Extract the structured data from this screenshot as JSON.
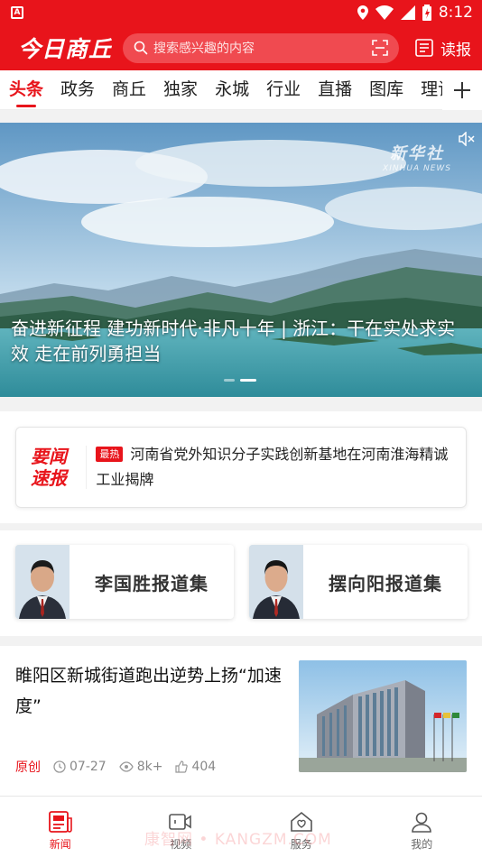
{
  "status_bar": {
    "app_icon_letter": "A",
    "time": "8:12"
  },
  "header": {
    "logo_text": "今日商丘",
    "search_placeholder": "搜索感兴趣的内容",
    "reader_label": "读报"
  },
  "tabs": {
    "items": [
      "头条",
      "政务",
      "商丘",
      "独家",
      "永城",
      "行业",
      "直播",
      "图库",
      "理论"
    ],
    "active_index": 0
  },
  "hero": {
    "caption": "奋进新征程 建功新时代·非凡十年 | 浙江：干在实处求实效 走在前列勇担当",
    "watermark_cn": "新华社",
    "watermark_en": "XINHUA NEWS",
    "slide_count": 2,
    "active_slide": 2
  },
  "news_flash": {
    "logo_line1": "要闻",
    "logo_line2": "速报",
    "tag": "最热",
    "headline": "河南省党外知识分子实践创新基地在河南淮海精诚工业揭牌"
  },
  "collections": [
    {
      "title": "李国胜报道集"
    },
    {
      "title": "摆向阳报道集"
    }
  ],
  "article": {
    "title": "睢阳区新城街道跑出逆势上扬“加速度”",
    "source": "原创",
    "date": "07-27",
    "views": "8k+",
    "likes": "404"
  },
  "bottom_nav": {
    "items": [
      "新闻",
      "视频",
      "服务",
      "我的"
    ],
    "active_index": 0
  },
  "site_watermark": "康智网 • KANGZM.COM",
  "colors": {
    "brand_red": "#e8141b",
    "search_bg": "#f04a50"
  },
  "icons": {
    "search": "search-icon",
    "scan": "scan-icon",
    "reader": "newspaper-icon",
    "add": "plus-icon",
    "mute": "mute-icon",
    "clock": "clock-icon",
    "eye": "eye-icon",
    "like": "thumb-up-icon"
  }
}
